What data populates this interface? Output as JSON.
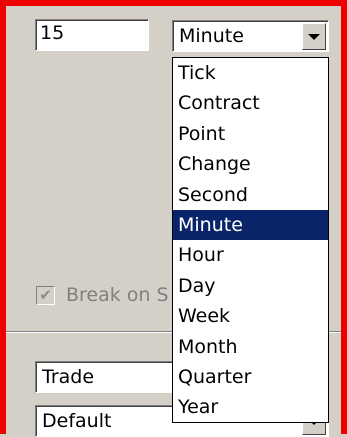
{
  "interval": {
    "value": "15",
    "unit_selected": "Minute"
  },
  "unit_options": [
    "Tick",
    "Contract",
    "Point",
    "Change",
    "Second",
    "Minute",
    "Hour",
    "Day",
    "Week",
    "Month",
    "Quarter",
    "Year"
  ],
  "break_on_session": {
    "label": "Break on S",
    "checked": true
  },
  "data_type": {
    "selected": "Trade"
  },
  "template": {
    "selected": "Default"
  },
  "colors": {
    "frame_border": "#ee0000",
    "selection": "#0a246a",
    "window_background": "#d4d0c8"
  }
}
